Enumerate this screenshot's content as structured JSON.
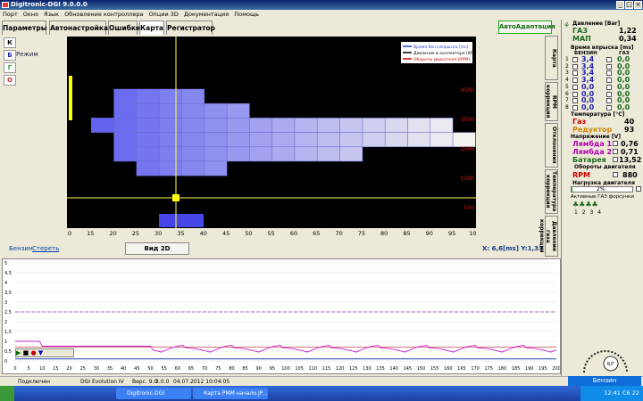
{
  "window": {
    "title": "Digitronic-DGI 9.0.0.0"
  },
  "menu": [
    "Порт",
    "Окно",
    "Язык",
    "Обновление контроллера",
    "Опции 3D",
    "Документация",
    "Помощь"
  ],
  "tabs": [
    "Параметры",
    "Автонастройка",
    "Ошибки",
    "Карта",
    "Регистратор"
  ],
  "autoadapt_label": "АвтоАдаптация",
  "left_buttons": [
    "К",
    "Б",
    "Г",
    "О"
  ],
  "mode_label": "Режим",
  "map": {
    "legend": [
      "Время бенз.впрыска [ms]",
      "Давление в коллекторе [KPa]",
      "Обороты двигателя [RPM]"
    ],
    "x_ticks": [
      "10",
      "15",
      "20",
      "25",
      "30",
      "35",
      "40",
      "45",
      "50",
      "55",
      "60",
      "65",
      "70",
      "75",
      "80",
      "85",
      "90",
      "95",
      "100"
    ],
    "y_ticks": [
      "4500",
      "3500",
      "2500",
      "1500",
      "500"
    ]
  },
  "bottombar": {
    "fuel_label": "Бензин",
    "erase_label": "Стереть",
    "view2d_label": "Вид 2D",
    "coords": "6,6[ms] Y:1,33",
    "coords_x": "X:"
  },
  "vtabs": [
    "Карта",
    "RPM коррекция",
    "Отклонения",
    "Температура коррекция",
    "Давление газа коррекция"
  ],
  "right": {
    "pressure_title": "Давление [Bar]",
    "gas_label": "ГАЗ",
    "gas_value": "1,22",
    "map_label": "МАП",
    "map_value": "0,34",
    "inj_title": "Время впрыска [ms]",
    "inj_col_benz": "БЕНЗИН",
    "inj_col_gas": "ГАЗ",
    "inj_rows": [
      {
        "n": "1",
        "b": "3,4",
        "g": "0,0"
      },
      {
        "n": "2",
        "b": "3,4",
        "g": "0,0"
      },
      {
        "n": "3",
        "b": "3,4",
        "g": "0,0"
      },
      {
        "n": "4",
        "b": "3,4",
        "g": "0,0"
      },
      {
        "n": "5",
        "b": "0,0",
        "g": "0,0"
      },
      {
        "n": "6",
        "b": "0,0",
        "g": "0,0"
      },
      {
        "n": "7",
        "b": "0,0",
        "g": "0,0"
      },
      {
        "n": "8",
        "b": "0,0",
        "g": "0,0"
      }
    ],
    "temp_title": "Температура [°C]",
    "temp_gas_label": "Газ",
    "temp_gas_value": "40",
    "temp_red_label": "Редуктор",
    "temp_red_value": "93",
    "volt_title": "Напряжение [V]",
    "lambda1_label": "Лямбда 1",
    "lambda1_value": "0,76",
    "lambda2_label": "Лямбда 2",
    "lambda2_value": "0,71",
    "battery_label": "Батарея",
    "battery_value": "13,52",
    "rpm_title": "Обороты двигателя",
    "rpm_label": "RPM",
    "rpm_value": "880",
    "load_title": "Нагрузка двигателя",
    "load_value": "2%",
    "injectors_title": "Активные ГАЗ форсунки",
    "injectors": [
      "1",
      "2",
      "3",
      "4"
    ]
  },
  "graph": {
    "y_ticks": [
      "5",
      "4,5",
      "4",
      "3,5",
      "3",
      "2,5",
      "2",
      "1,5",
      "1",
      "0,5",
      "0"
    ],
    "x_ticks": [
      "0",
      "5",
      "10",
      "15",
      "20",
      "25",
      "30",
      "35",
      "40",
      "45",
      "50",
      "55",
      "60",
      "65",
      "70",
      "75",
      "80",
      "85",
      "90",
      "95",
      "100",
      "105",
      "110",
      "115",
      "120",
      "125",
      "130",
      "135",
      "140",
      "145",
      "150",
      "155",
      "160",
      "165",
      "170",
      "175",
      "180",
      "185",
      "190",
      "195",
      "200"
    ]
  },
  "status": {
    "left": "Подключен",
    "model": "DGI Evolution IV",
    "ver": "Верс. 9.0",
    "num": "3.0.0",
    "date": "04.07.2012 10:04:05"
  },
  "benzin_bar": "Бензин",
  "taskbar": {
    "tasks": [
      "Digitronic-DGI",
      "Карта PMM начало.JP..."
    ],
    "clock": "12:41 C6 22"
  },
  "colors": {
    "accent": "#1a6a1a",
    "map_cell": "#5a5af0",
    "lambda": "#b000b0",
    "rpm": "#cc0000"
  }
}
